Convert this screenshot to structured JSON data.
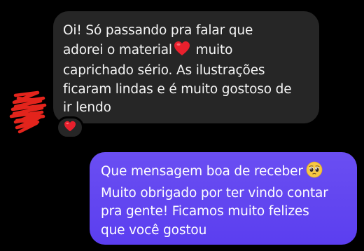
{
  "conversation": {
    "incoming": {
      "line1": "Oi! Só passando pra falar que",
      "line2_before_emoji": "adorei o material",
      "emoji_inline": "heart-emoji",
      "line2_after_emoji": "muito",
      "line3": "caprichado sério. As ilustrações",
      "line4": "ficaram lindas e é muito gostoso de",
      "line5": "ir lendo",
      "reaction": "heart-emoji"
    },
    "outgoing": {
      "line1_before_emoji": "Que mensagem boa de receber",
      "emoji_inline": "pleading-face-emoji",
      "line2": "Muito obrigado por ter vindo contar",
      "line3": "pra gente! Ficamos muito felizes",
      "line4": "que você gostou"
    }
  },
  "colors": {
    "background": "#000000",
    "incoming_bubble": "#262626",
    "outgoing_bubble": "#6246f0",
    "heart": "#e8202d",
    "scribble": "#e3241c"
  }
}
